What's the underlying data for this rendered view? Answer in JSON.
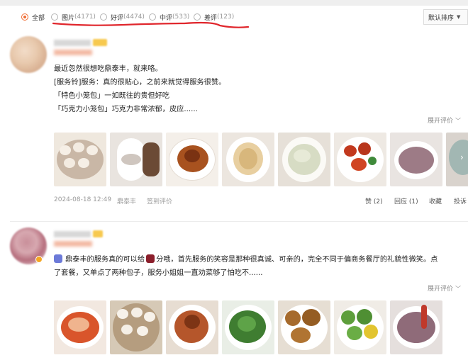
{
  "filters": {
    "all": {
      "label": "全部"
    },
    "photos": {
      "label": "图片",
      "count": "(4171)"
    },
    "good": {
      "label": "好评",
      "count": "(4474)"
    },
    "medium": {
      "label": "中评",
      "count": "(533)"
    },
    "bad": {
      "label": "差评",
      "count": "(123)"
    }
  },
  "sort": {
    "label": "默认排序"
  },
  "reviews": [
    {
      "lines": [
        "最近忽然很想吃鼎泰丰，就来咯。",
        "[服务铃]服务：真的很贴心，之前来就觉得服务很赞。",
        "「特色小笼包」一如既往的贵但好吃",
        "「巧克力小笼包」巧克力非常浓郁，皮应......"
      ],
      "expand_label": "展开评价",
      "date": "2024-08-18 12:49",
      "shop": "鼎泰丰",
      "checkin": "签到评价",
      "like": "赞 (2)",
      "reply": "回应 (1)",
      "collect": "收藏",
      "report": "投诉"
    },
    {
      "line1_a": "鼎泰丰的服务真的可以给",
      "line1_b": "分哦，首先服务的笑容是那种很真诚、可亲的，完全不同于偏商务餐厅的礼貌性微笑。点",
      "line2": "了套餐，又单点了两种包子，服务小姐姐一直劝菜够了怕吃不......",
      "expand_label": "展开评价"
    }
  ],
  "colors": {
    "accent": "#f06d34",
    "hand_underline": "#e0262c"
  }
}
